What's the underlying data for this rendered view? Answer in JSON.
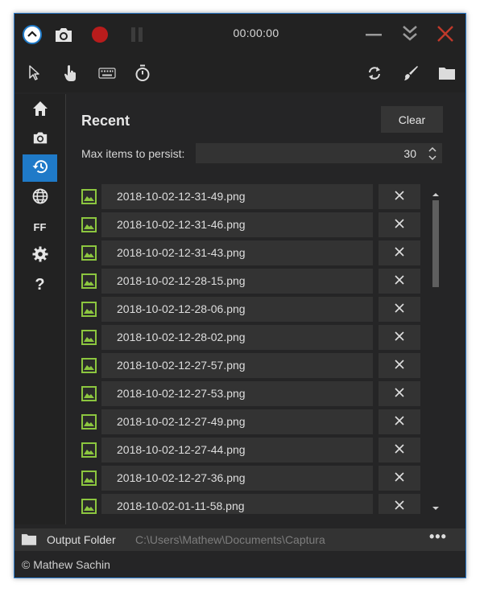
{
  "titlebar": {
    "timer": "00:00:00",
    "icons": [
      "collapse-icon",
      "screenshot-icon",
      "record-icon",
      "pause-icon",
      "minimize-icon",
      "minimize-to-tray-icon",
      "close-icon"
    ],
    "record_color": "#b81c1c",
    "close_color": "#c0392b"
  },
  "toolbar": {
    "icons": [
      "cursor-icon",
      "click-icon",
      "keystrokes-icon",
      "timer-icon",
      "refresh-icon",
      "brush-icon",
      "folder-icon"
    ]
  },
  "sidebar": {
    "items": [
      {
        "name": "home",
        "icon": "home-icon"
      },
      {
        "name": "screenshot",
        "icon": "camera-icon"
      },
      {
        "name": "recent",
        "icon": "history-icon",
        "active": true
      },
      {
        "name": "web",
        "icon": "globe-icon"
      },
      {
        "name": "ffmpeg",
        "label": "FF"
      },
      {
        "name": "settings",
        "icon": "gear-icon"
      },
      {
        "name": "about",
        "label": "?"
      }
    ],
    "active_color": "#1f7ac8"
  },
  "recent": {
    "title": "Recent",
    "clear_label": "Clear",
    "max_items_label": "Max items to persist:",
    "max_items_value": "30",
    "items": [
      "2018-10-02-12-31-49.png",
      "2018-10-02-12-31-46.png",
      "2018-10-02-12-31-43.png",
      "2018-10-02-12-28-15.png",
      "2018-10-02-12-28-06.png",
      "2018-10-02-12-28-02.png",
      "2018-10-02-12-27-57.png",
      "2018-10-02-12-27-53.png",
      "2018-10-02-12-27-49.png",
      "2018-10-02-12-27-44.png",
      "2018-10-02-12-27-36.png",
      "2018-10-02-01-11-58.png"
    ],
    "image_icon_color": "#8cc63f"
  },
  "footer": {
    "label": "Output Folder",
    "path": "C:\\Users\\Mathew\\Documents\\Captura",
    "more": "•••"
  },
  "copyright": "© Mathew Sachin"
}
